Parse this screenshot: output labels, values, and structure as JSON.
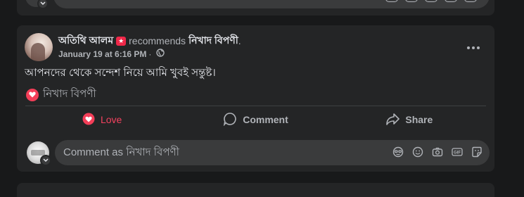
{
  "post": {
    "author": "অতিথি আলম",
    "recommends_label": "recommends",
    "page_name": "নিখাদ বিপণী",
    "period": ".",
    "date": "January 19 at 6:16 PM",
    "separator": "·",
    "text": "আপনদের থেকে সন্দেশ নিয়ে আমি খুবই সন্তুষ্ট।",
    "reaction_name": "নিখাদ বিপণী"
  },
  "actions": {
    "love_label": "Love",
    "comment_label": "Comment",
    "share_label": "Share"
  },
  "comment_box": {
    "placeholder": "Comment as নিখাদ বিপণী",
    "icons": [
      "avatar-sticker-icon",
      "emoji-icon",
      "camera-icon",
      "gif-icon",
      "sticker-icon"
    ]
  },
  "colors": {
    "background": "#18191a",
    "card": "#242526",
    "love": "#f3425f",
    "recommend": "#f02849",
    "secondary_text": "#b0b3b8"
  }
}
